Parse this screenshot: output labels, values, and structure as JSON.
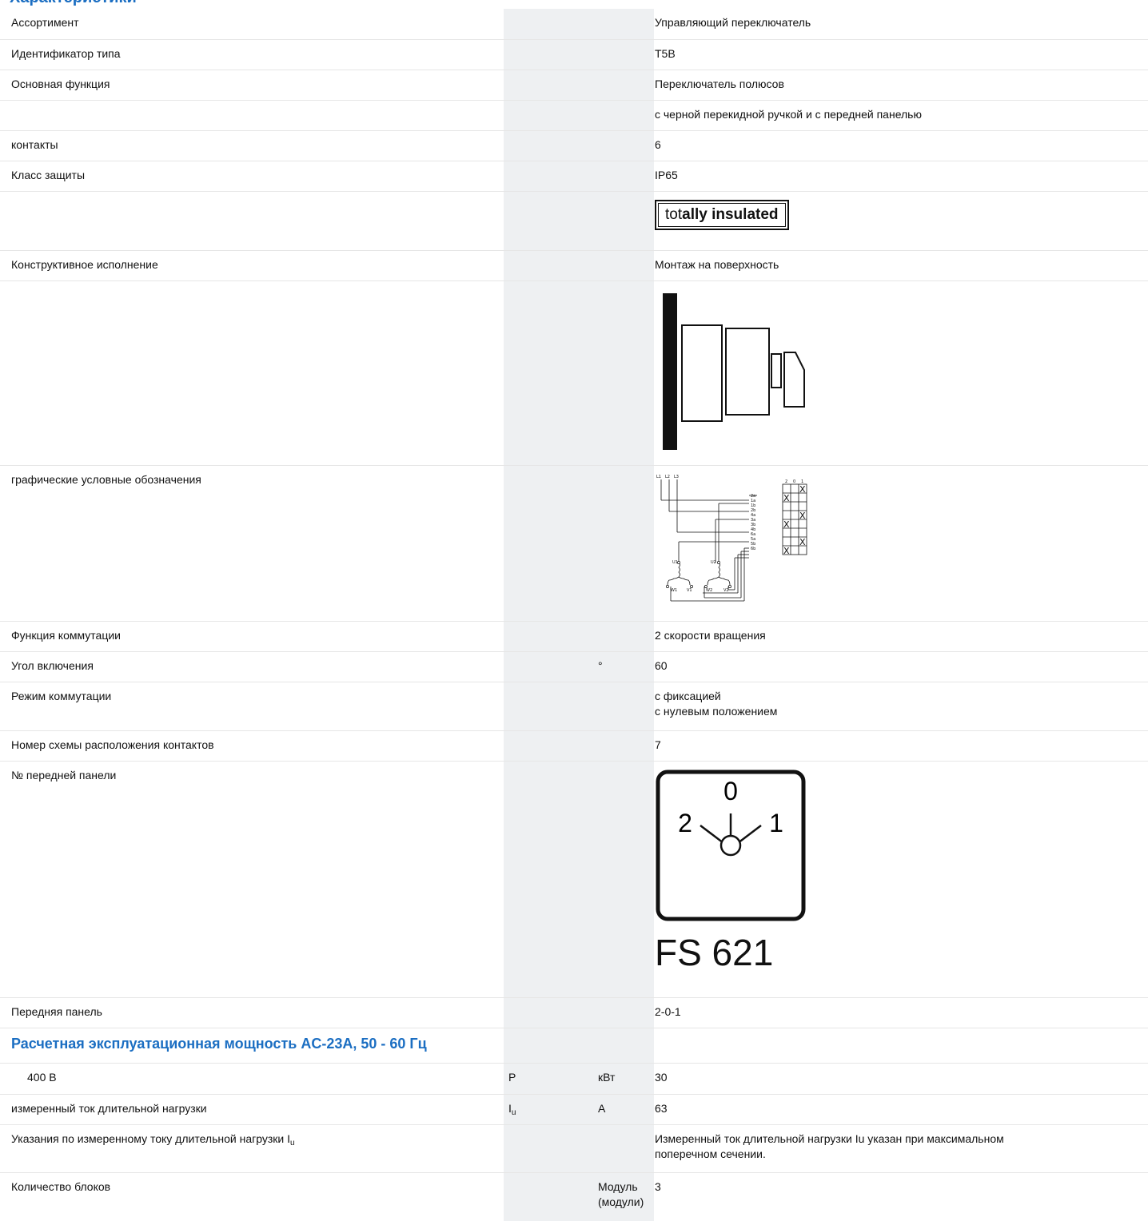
{
  "page_title": "Характеристики",
  "rows": [
    {
      "label": "Ассортимент",
      "value": "Управляющий переключатель"
    },
    {
      "label": "Идентификатор типа",
      "value": "T5B"
    },
    {
      "label": "Основная функция",
      "value": "Переключатель полюсов"
    },
    {
      "label": "",
      "value": "с черной перекидной ручкой и с передней панелью"
    },
    {
      "label": "контакты",
      "value": "6"
    },
    {
      "label": "Класс защиты",
      "value": "IP65"
    },
    {
      "label": "Конструктивное исполнение",
      "value": "Монтаж на поверхность"
    },
    {
      "label": "графические условные обозначения"
    },
    {
      "label": "Функция коммутации",
      "value": "2 скорости вращения"
    },
    {
      "label": "Угол включения",
      "unit": "°",
      "value": "60"
    },
    {
      "label": "Режим коммутации",
      "value_line1": "с фиксацией",
      "value_line2": "с нулевым положением"
    },
    {
      "label": "Номер схемы расположения контактов",
      "value": "7"
    },
    {
      "label": "№ передней панели",
      "value": "FS 621"
    },
    {
      "label": "Передняя панель",
      "value": "2-0-1"
    },
    {
      "label": "400 В",
      "symbol": "P",
      "unit": "кВт",
      "value": "30"
    },
    {
      "label": "измеренный ток длительной нагрузки",
      "symbol": "I",
      "symbol_sub": "u",
      "unit": "A",
      "value": "63"
    },
    {
      "label": "Указания по измеренному току длительной нагрузки I",
      "label_sub": "u",
      "value_line1": "Измеренный ток длительной нагрузки Iu указан при максимальном",
      "value_line2": "поперечном сечении."
    },
    {
      "label": "Количество блоков",
      "unit_line1": "Модуль",
      "unit_line2": "(модули)",
      "value": "3"
    }
  ],
  "section_heading": "Расчетная эксплуатационная мощность AC-23A, 50 - 60 Гц",
  "insulation_badge": {
    "part1": "tot",
    "part2": "ally",
    "part3": "insulated"
  },
  "front_plate_positions": {
    "top": "0",
    "left": "2",
    "right": "1"
  },
  "circuit_labels": {
    "lines": [
      "L1",
      "L2",
      "L3"
    ],
    "terminals": [
      "2a",
      "1a",
      "1b",
      "2b",
      "4a",
      "3a",
      "3b",
      "4b",
      "6a",
      "5a",
      "5b",
      "6b"
    ],
    "windings": [
      "U1",
      "U2",
      "W1",
      "V1",
      "W2",
      "V2"
    ],
    "table_header": [
      "2",
      "0",
      "1"
    ]
  }
}
